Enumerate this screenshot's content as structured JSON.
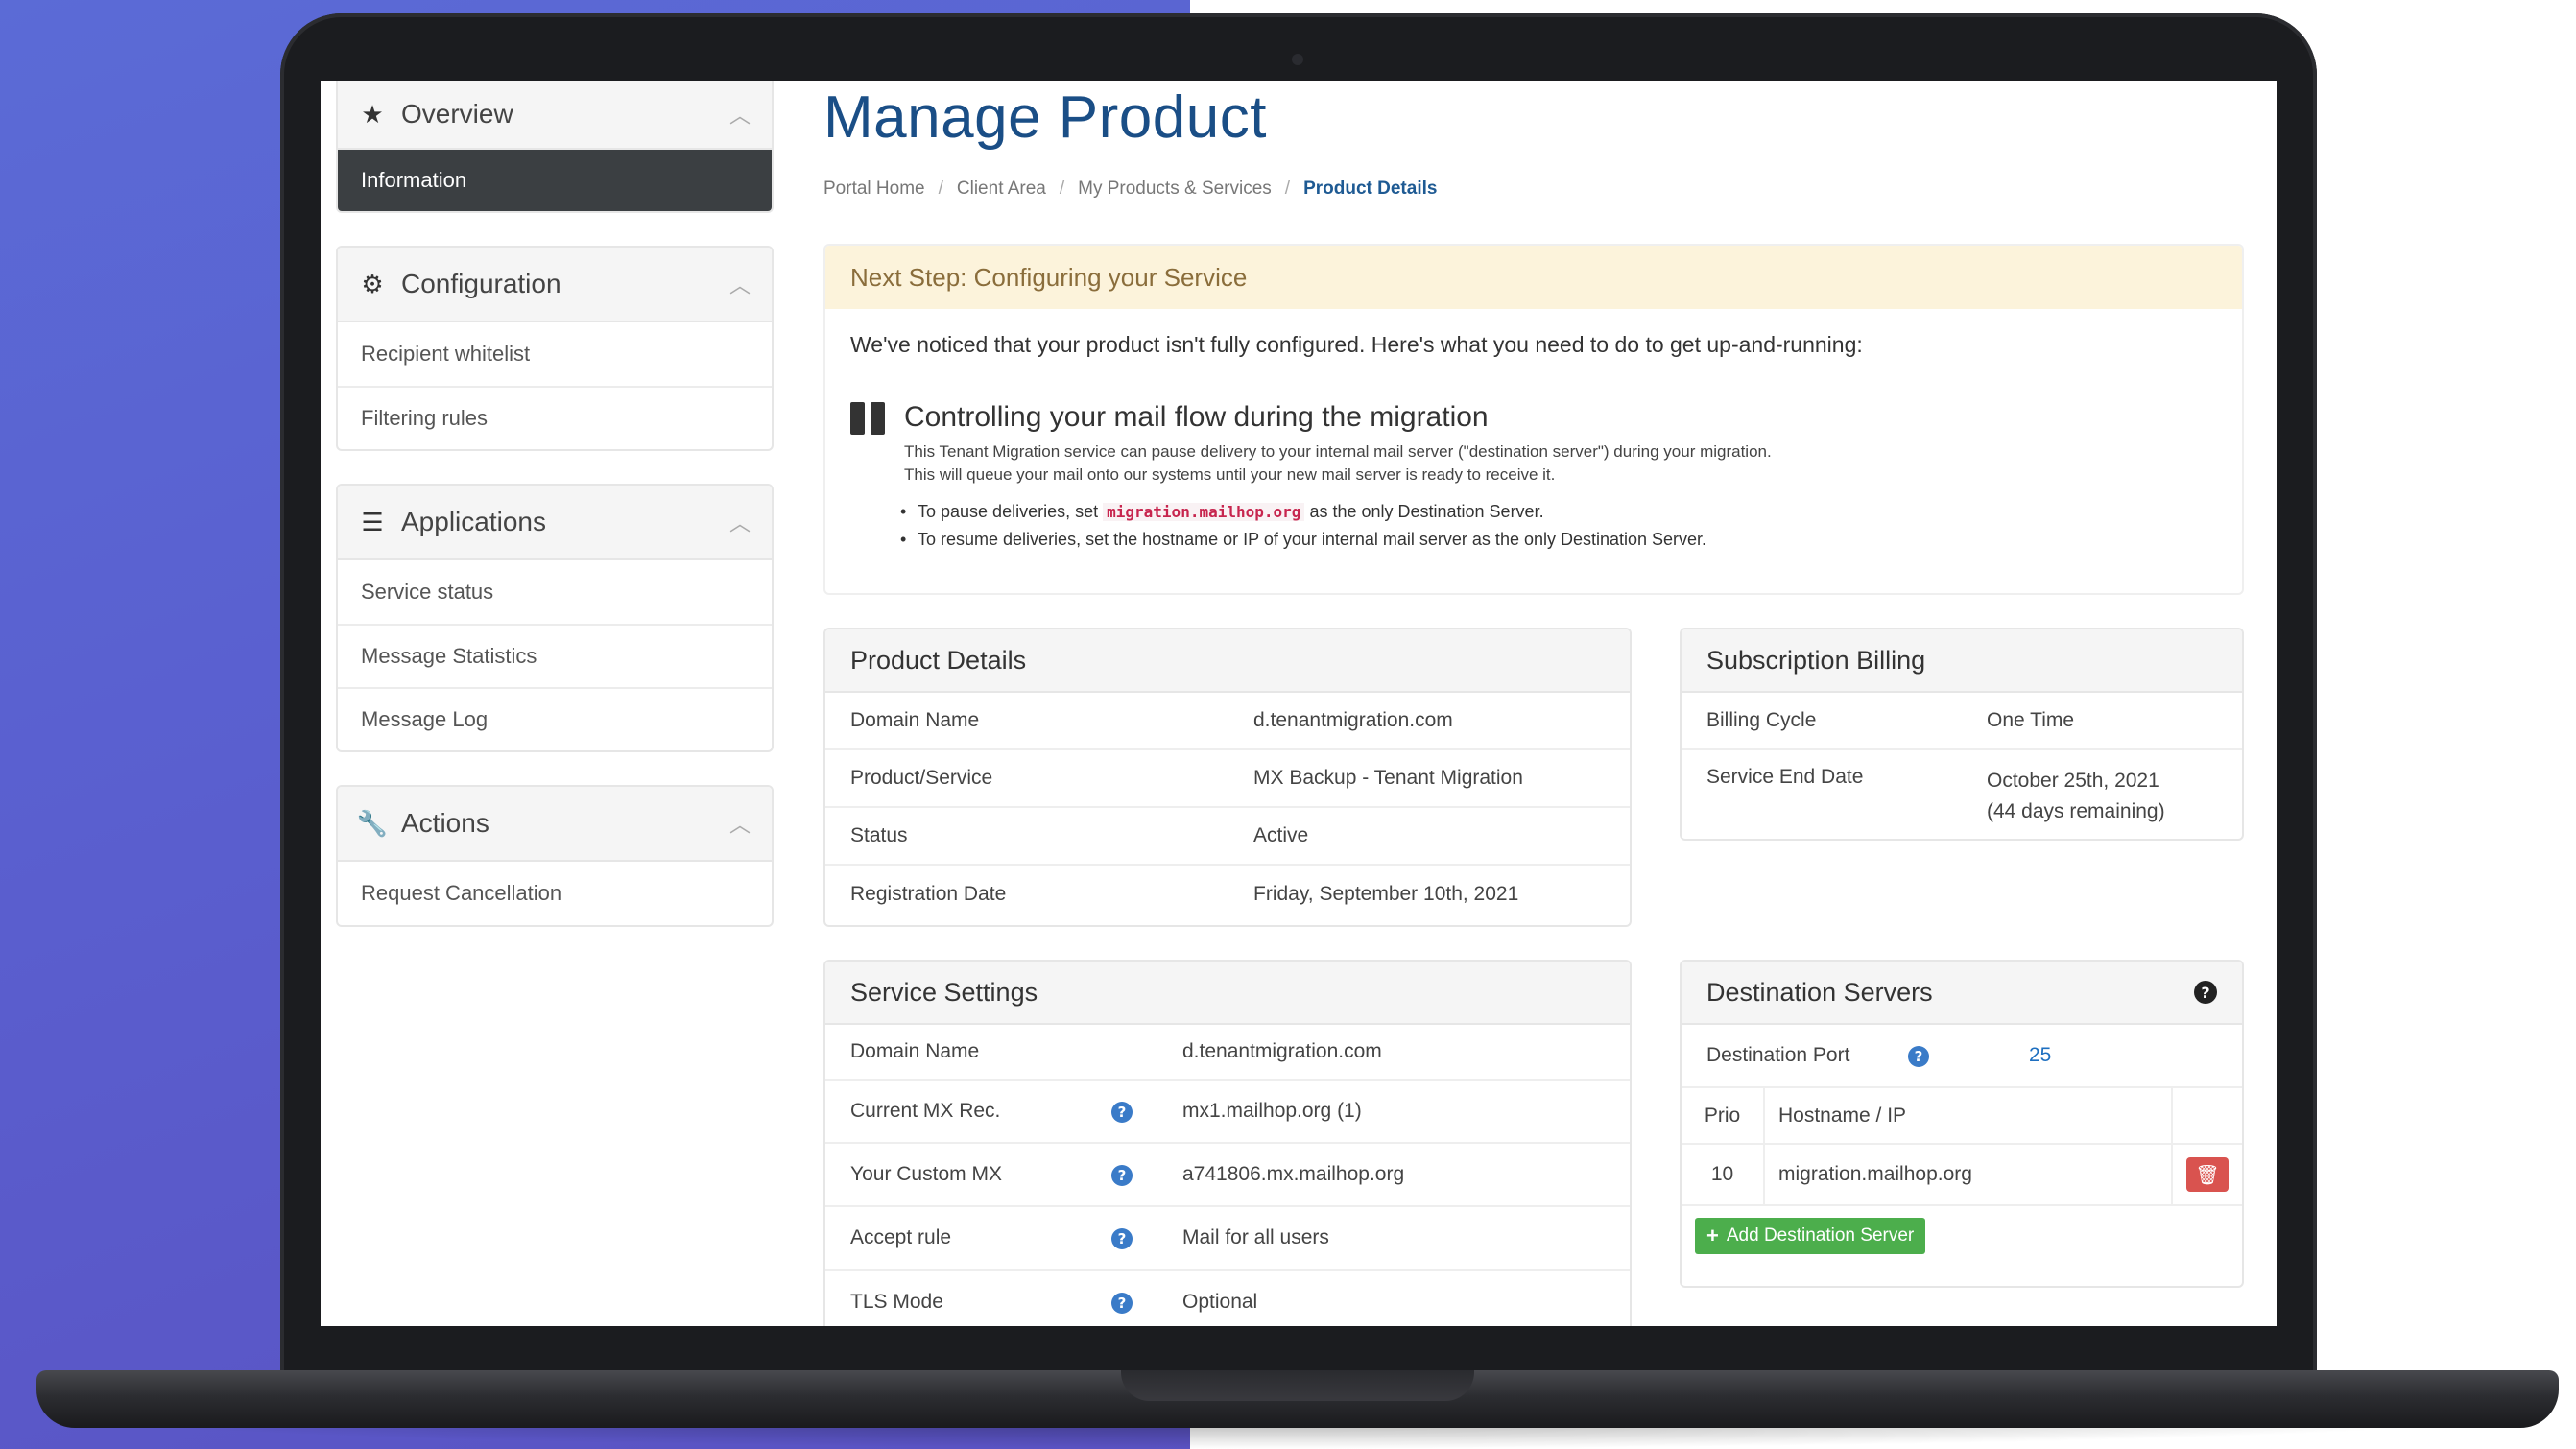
{
  "sidebar": {
    "overview": {
      "title": "Overview",
      "items": [
        "Information"
      ]
    },
    "configuration": {
      "title": "Configuration",
      "items": [
        "Recipient whitelist",
        "Filtering rules"
      ]
    },
    "applications": {
      "title": "Applications",
      "items": [
        "Service status",
        "Message Statistics",
        "Message Log"
      ]
    },
    "actions": {
      "title": "Actions",
      "items": [
        "Request Cancellation"
      ]
    }
  },
  "page": {
    "title": "Manage Product",
    "breadcrumb": [
      "Portal Home",
      "Client Area",
      "My Products & Services",
      "Product Details"
    ]
  },
  "alert": {
    "header": "Next Step: Configuring your Service",
    "intro": "We've noticed that your product isn't fully configured. Here's what you need to do to get up-and-running:",
    "step_title": "Controlling your mail flow during the migration",
    "desc_line1": "This Tenant Migration service can pause delivery to your internal mail server (\"destination server\") during your migration.",
    "desc_line2": "This will queue your mail onto our systems until your new mail server is ready to receive it.",
    "bullet1_pre": "To pause deliveries, set",
    "bullet1_code": "migration.mailhop.org",
    "bullet1_post": "as the only Destination Server.",
    "bullet2": "To resume deliveries, set the hostname or IP of your internal mail server as the only Destination Server."
  },
  "product_details": {
    "title": "Product Details",
    "rows": [
      {
        "k": "Domain Name",
        "v": "d.tenantmigration.com"
      },
      {
        "k": "Product/Service",
        "v": "MX Backup - Tenant Migration"
      },
      {
        "k": "Status",
        "v": "Active"
      },
      {
        "k": "Registration Date",
        "v": "Friday, September 10th, 2021"
      }
    ]
  },
  "billing": {
    "title": "Subscription Billing",
    "cycle_label": "Billing Cycle",
    "cycle_value": "One Time",
    "end_label": "Service End Date",
    "end_value": "October 25th, 2021",
    "remaining": "(44 days remaining)"
  },
  "service_settings": {
    "title": "Service Settings",
    "rows": [
      {
        "k": "Domain Name",
        "v": "d.tenantmigration.com"
      },
      {
        "k": "Current MX Rec.",
        "v": "mx1.mailhop.org (1)"
      },
      {
        "k": "Your Custom MX",
        "v": "a741806.mx.mailhop.org"
      },
      {
        "k": "Accept rule",
        "v": "Mail for all users"
      },
      {
        "k": "TLS Mode",
        "v": "Optional"
      }
    ]
  },
  "destination": {
    "title": "Destination Servers",
    "port_label": "Destination Port",
    "port_value": "25",
    "col_prio": "Prio",
    "col_host": "Hostname / IP",
    "rows": [
      {
        "prio": "10",
        "host": "migration.mailhop.org"
      }
    ],
    "add_label": "Add Destination Server"
  },
  "colors": {
    "brand_title": "#1a4e86",
    "alert_bg": "#fcf3db",
    "danger": "#d9534f",
    "success": "#4cae4c",
    "active_nav": "#3b3f42"
  }
}
